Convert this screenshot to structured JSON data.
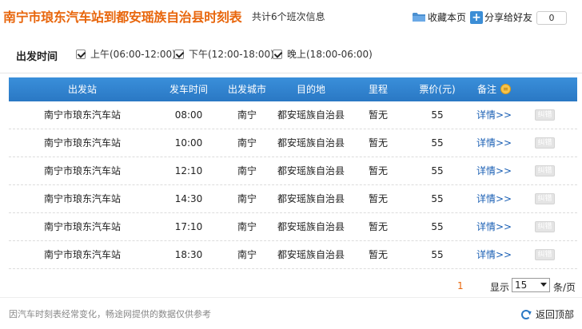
{
  "header": {
    "title": "南宁市琅东汽车站到都安瑶族自治县时刻表",
    "subtitle": "共计6个班次信息",
    "favorite_label": "收藏本页",
    "share_label": "分享给好友",
    "share_count": "0"
  },
  "filter": {
    "label": "出发时间",
    "options": [
      {
        "label": "上午(06:00-12:00)",
        "checked": true
      },
      {
        "label": "下午(12:00-18:00)",
        "checked": true
      },
      {
        "label": "晚上(18:00-06:00)",
        "checked": true
      }
    ]
  },
  "table": {
    "columns": [
      "出发站",
      "发车时间",
      "出发城市",
      "目的地",
      "里程",
      "票价(元)",
      "备注"
    ],
    "detail_label": "详情>>",
    "report_label": "纠错",
    "rows": [
      {
        "station": "南宁市琅东汽车站",
        "time": "08:00",
        "city": "南宁",
        "dest": "都安瑶族自治县",
        "mileage": "暂无",
        "price": "55"
      },
      {
        "station": "南宁市琅东汽车站",
        "time": "10:00",
        "city": "南宁",
        "dest": "都安瑶族自治县",
        "mileage": "暂无",
        "price": "55"
      },
      {
        "station": "南宁市琅东汽车站",
        "time": "12:10",
        "city": "南宁",
        "dest": "都安瑶族自治县",
        "mileage": "暂无",
        "price": "55"
      },
      {
        "station": "南宁市琅东汽车站",
        "time": "14:30",
        "city": "南宁",
        "dest": "都安瑶族自治县",
        "mileage": "暂无",
        "price": "55"
      },
      {
        "station": "南宁市琅东汽车站",
        "time": "17:10",
        "city": "南宁",
        "dest": "都安瑶族自治县",
        "mileage": "暂无",
        "price": "55"
      },
      {
        "station": "南宁市琅东汽车站",
        "time": "18:30",
        "city": "南宁",
        "dest": "都安瑶族自治县",
        "mileage": "暂无",
        "price": "55"
      }
    ]
  },
  "pager": {
    "current_page": "1",
    "show_label": "显示",
    "per_page": "15",
    "per_page_unit": "条/页"
  },
  "footer": {
    "note": "因汽车时刻表经常变化，畅途网提供的数据仅供参考",
    "back_top_label": "返回顶部"
  },
  "colors": {
    "title": "#e8660c",
    "table_header": "#2a78c4",
    "link": "#1a5fb4"
  },
  "icons": [
    "folder-icon",
    "plus-icon",
    "checkbox-icon",
    "coin-icon",
    "chevron-down-icon",
    "refresh-icon"
  ]
}
